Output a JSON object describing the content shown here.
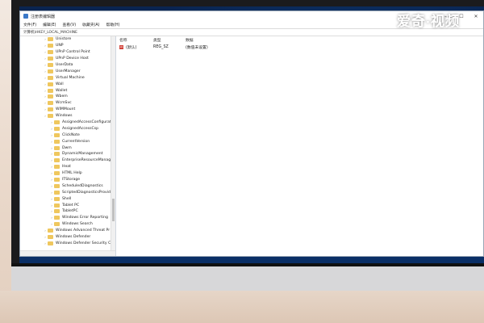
{
  "window": {
    "title": "注册表编辑器",
    "menu": [
      "文件(F)",
      "编辑(E)",
      "查看(V)",
      "收藏夹(A)",
      "帮助(H)"
    ],
    "address": "计算机\\HKEY_LOCAL_MACHINE",
    "controls": [
      "—",
      "☐",
      "✕"
    ]
  },
  "tree": {
    "items": [
      {
        "label": "Unistore",
        "indent": 0
      },
      {
        "label": "UNP",
        "indent": 0
      },
      {
        "label": "UPnP Control Point",
        "indent": 0
      },
      {
        "label": "UPnP Device Host",
        "indent": 0
      },
      {
        "label": "UserData",
        "indent": 0
      },
      {
        "label": "UserManager",
        "indent": 0
      },
      {
        "label": "Virtual Machine",
        "indent": 0
      },
      {
        "label": "Wall",
        "indent": 0
      },
      {
        "label": "Wallet",
        "indent": 0
      },
      {
        "label": "Wbem",
        "indent": 0
      },
      {
        "label": "WcmSvc",
        "indent": 0
      },
      {
        "label": "WIMMount",
        "indent": 0
      },
      {
        "label": "Windows",
        "indent": 0
      },
      {
        "label": "AssignedAccessConfiguratio",
        "indent": 1
      },
      {
        "label": "AssignedAccessCsp",
        "indent": 1
      },
      {
        "label": "ClickNote",
        "indent": 1
      },
      {
        "label": "CurrentVersion",
        "indent": 1,
        "selected": true
      },
      {
        "label": "Dwm",
        "indent": 1
      },
      {
        "label": "DynamicManagement",
        "indent": 1
      },
      {
        "label": "EnterpriseResourceManage",
        "indent": 1
      },
      {
        "label": "Heat",
        "indent": 1
      },
      {
        "label": "HTML Help",
        "indent": 1
      },
      {
        "label": "ITStorage",
        "indent": 1
      },
      {
        "label": "ScheduledDiagnostics",
        "indent": 1
      },
      {
        "label": "ScriptedDiagnosticsProvide",
        "indent": 1
      },
      {
        "label": "Shell",
        "indent": 1
      },
      {
        "label": "Tablet PC",
        "indent": 1
      },
      {
        "label": "TabletPC",
        "indent": 1
      },
      {
        "label": "Windows Error Reporting",
        "indent": 1
      },
      {
        "label": "Windows Search",
        "indent": 1
      },
      {
        "label": "Windows Advanced Threat Pr",
        "indent": 0
      },
      {
        "label": "Windows Defender",
        "indent": 0
      },
      {
        "label": "Windows Defender Security C",
        "indent": 0
      }
    ]
  },
  "details": {
    "columns": [
      "名称",
      "类型",
      "数据"
    ],
    "rows": [
      {
        "name": "(默认)",
        "type": "REG_SZ",
        "data": "(数值未设置)"
      }
    ]
  },
  "watermark": {
    "text": "爱奇",
    "dot": "·",
    "suffix": "视频"
  }
}
